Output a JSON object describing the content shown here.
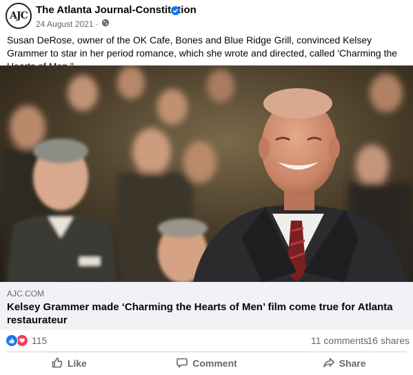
{
  "post": {
    "avatar_text": "AJC",
    "page_name": "The Atlanta Journal-Constitution",
    "date": "24 August 2021 ·",
    "text": "Susan DeRose, owner of the OK Cafe, Bones and Blue Ridge Grill, convinced Kelsey Grammer to star in her period romance, which she wrote and directed, called 'Charming the Hearts of Men.\""
  },
  "link": {
    "domain": "AJC.COM",
    "title": "Kelsey Grammer made ‘Charming the Hearts of Men’ film come true for Atlanta restaurateur"
  },
  "stats": {
    "reaction_count": "115",
    "comments": "11 comments",
    "shares": "16 shares"
  },
  "actions": {
    "like": "Like",
    "comment": "Comment",
    "share": "Share"
  },
  "icons": {
    "verified": "verified-badge-icon",
    "audience": "globe-icon",
    "like": "thumbs-up-icon",
    "comment": "comment-bubble-icon",
    "share": "share-arrow-icon"
  },
  "colors": {
    "brand_blue": "#1877f2",
    "love_red": "#f33e58",
    "secondary_text": "#65676b",
    "link_box_bg": "#f0f2f5"
  }
}
